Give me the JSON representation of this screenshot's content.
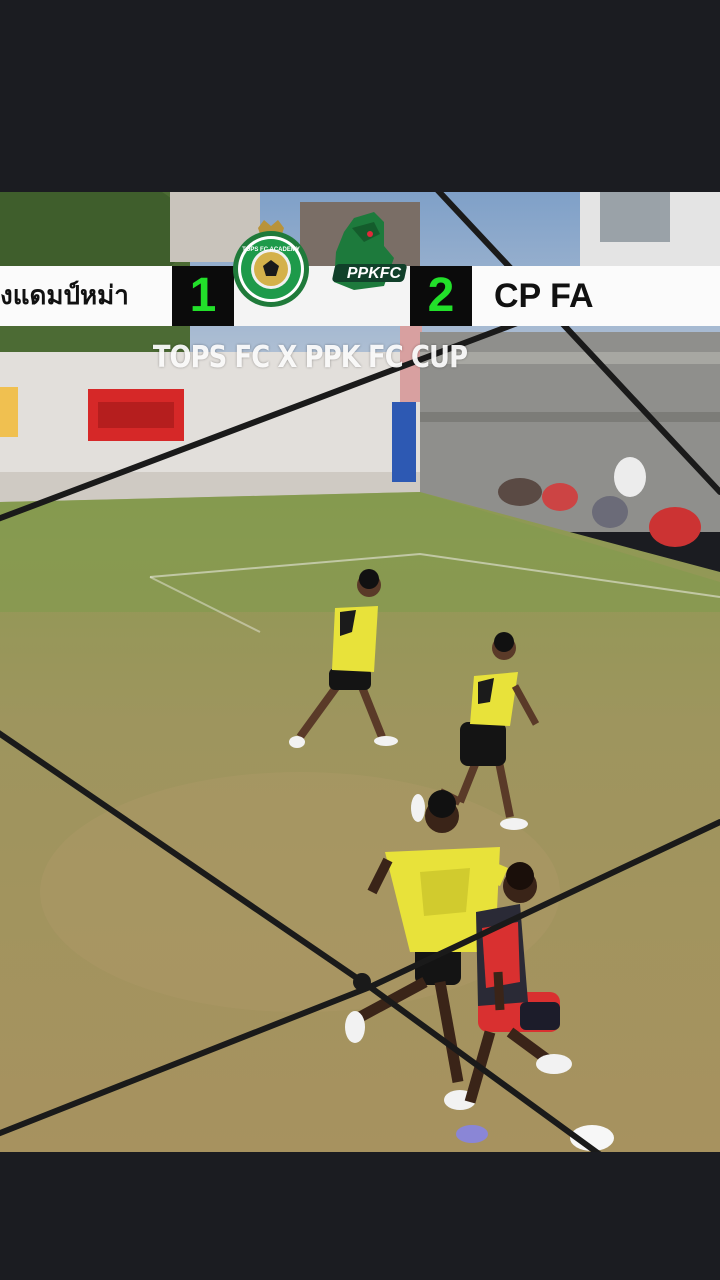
{
  "scoreboard": {
    "home_team": "งแดมป์หม่า",
    "home_score": "1",
    "away_score": "2",
    "away_team": "CP FA",
    "home_logo_text": "TOPS FC ACADEMY",
    "away_logo_text": "PPKFC"
  },
  "tournament_title": "TOPS FC X PPK FC CUP",
  "colors": {
    "score_text": "#22e02a",
    "score_bg": "#0b0b0b",
    "home_kit": "#e8e23a",
    "away_kit": "#d93030",
    "banner": "#d62828"
  }
}
